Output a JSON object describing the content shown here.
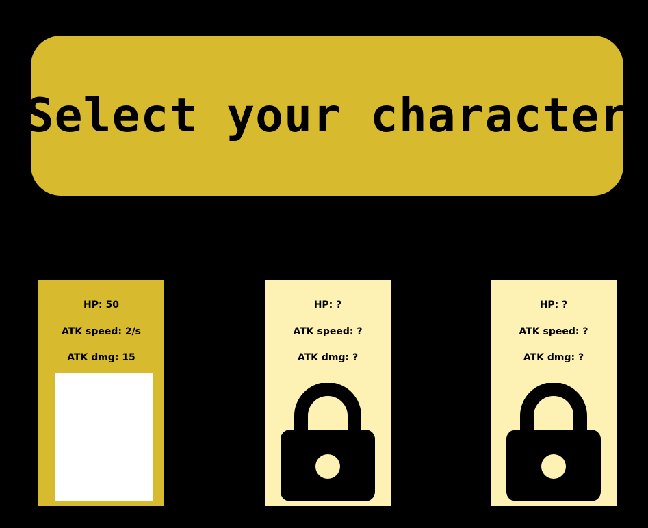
{
  "title": "Select your character",
  "colors": {
    "background": "#000000",
    "banner": "#d8ba2f",
    "card_selected": "#d8ba2f",
    "card_locked": "#fdf2b3",
    "portrait": "#ffffff"
  },
  "characters": [
    {
      "state": "selected",
      "hp": "HP: 50",
      "atk_speed": "ATK speed: 2/s",
      "atk_dmg": "ATK dmg: 15",
      "icon": "portrait-placeholder"
    },
    {
      "state": "locked",
      "hp": "HP: ?",
      "atk_speed": "ATK speed: ?",
      "atk_dmg": "ATK dmg: ?",
      "icon": "lock-icon"
    },
    {
      "state": "locked",
      "hp": "HP: ?",
      "atk_speed": "ATK speed: ?",
      "atk_dmg": "ATK dmg: ?",
      "icon": "lock-icon"
    }
  ]
}
